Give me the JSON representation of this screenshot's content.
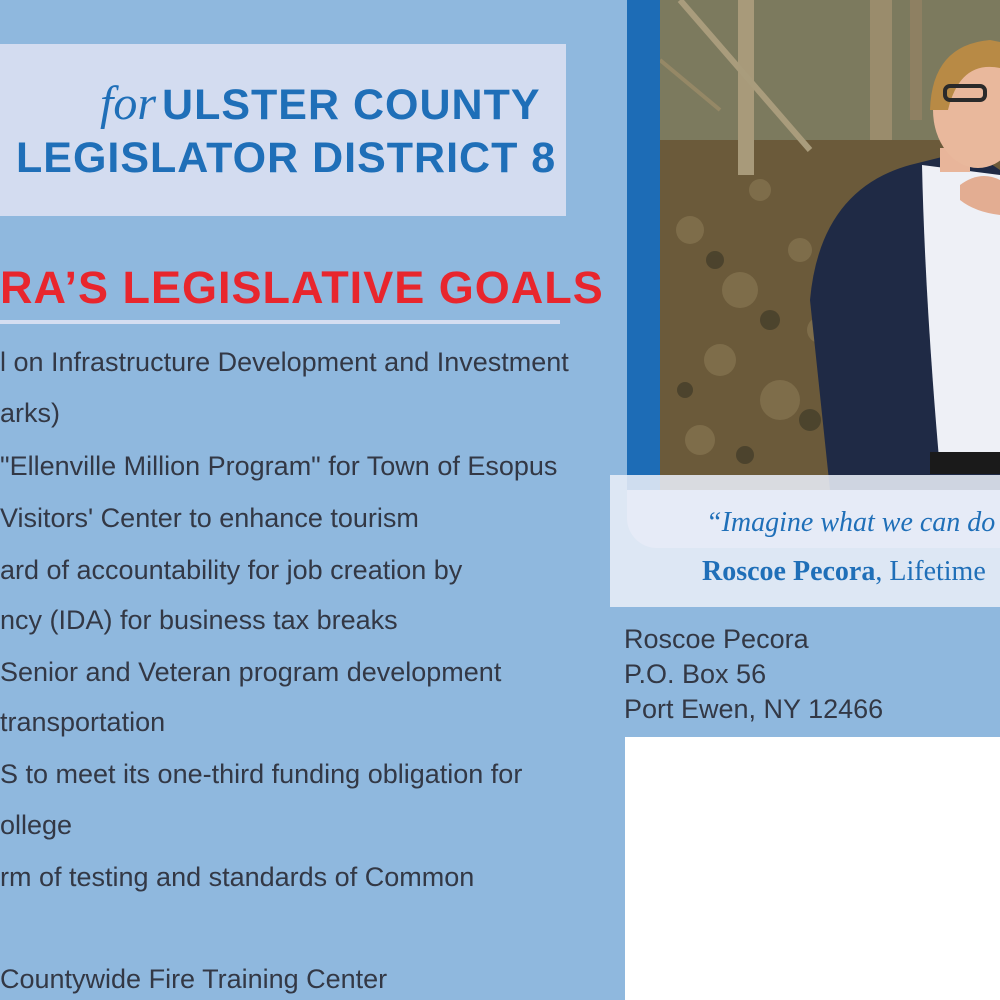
{
  "header": {
    "for_word": "for",
    "line1": "ULSTER COUNTY",
    "line2": "LEGISLATOR DISTRICT 8"
  },
  "goals": {
    "heading": "RA’S LEGISLATIVE GOALS",
    "lines": [
      "l on Infrastructure Development and Investment",
      "arks)",
      "\"Ellenville Million Program\" for Town of Esopus",
      "Visitors' Center to enhance tourism",
      "ard of accountability for job creation by",
      "ncy (IDA) for business tax breaks",
      "Senior and Veteran program development",
      "transportation",
      "S to meet its one-third funding obligation for",
      "ollege",
      "rm of testing and standards of Common",
      "",
      "Countywide Fire Training Center"
    ]
  },
  "quote": {
    "text": "“Imagine what we can do",
    "author_name": "Roscoe Pecora",
    "author_suffix": ", Lifetime"
  },
  "return_address": {
    "line1": "Roscoe Pecora",
    "line2": "P.O. Box 56",
    "line3": "Port Ewen, NY 12466"
  },
  "colors": {
    "background": "#8fb8de",
    "title_blue": "#1f6fb8",
    "heading_red": "#e8262d",
    "title_box": "#d3dcf0",
    "frame_blue": "#1d6cb6"
  }
}
